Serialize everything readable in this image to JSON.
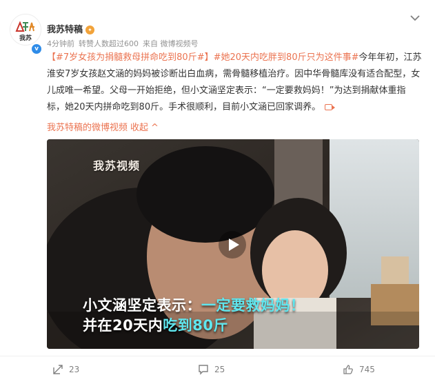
{
  "author": {
    "name": "我苏特稿",
    "avatar_text": "我苏"
  },
  "meta": {
    "time": "4分钟前",
    "repost_note": "转赞人数超过600",
    "source": "来自 微博视频号"
  },
  "post": {
    "hashtag1": "【#7岁女孩为捐髓救母拼命吃到80斤#】",
    "hashtag2": "#她20天内吃胖到80斤只为这件事#",
    "body": "今年年初，江苏淮安7岁女孩赵文涵的妈妈被诊断出白血病，需骨髓移植治疗。因中华骨髓库没有适合配型，女儿成唯一希望。父母一开始拒绝，但小文涵坚定表示：“一定要救妈妈！”为达到捐献体重指标，她20天内拼命吃到80斤。手术很顺利，目前小文涵已回家调养。"
  },
  "links": {
    "video_source": "我苏特稿的微博视频",
    "collapse": "收起",
    "collapse_arrow": "^"
  },
  "video": {
    "watermark": "我苏视频",
    "subtitle_line1_plain": "小文涵坚定表示：",
    "subtitle_line1_highlight": "一定要救妈妈！",
    "subtitle_line2_plain": "并在20天内",
    "subtitle_line2_highlight": "吃到80斤"
  },
  "actions": {
    "repost_count": "23",
    "comment_count": "25",
    "like_count": "745"
  },
  "colors": {
    "accent": "#eb7350",
    "subtitle_highlight": "#5fe6ee",
    "verified_blue": "#2f8ce8"
  }
}
